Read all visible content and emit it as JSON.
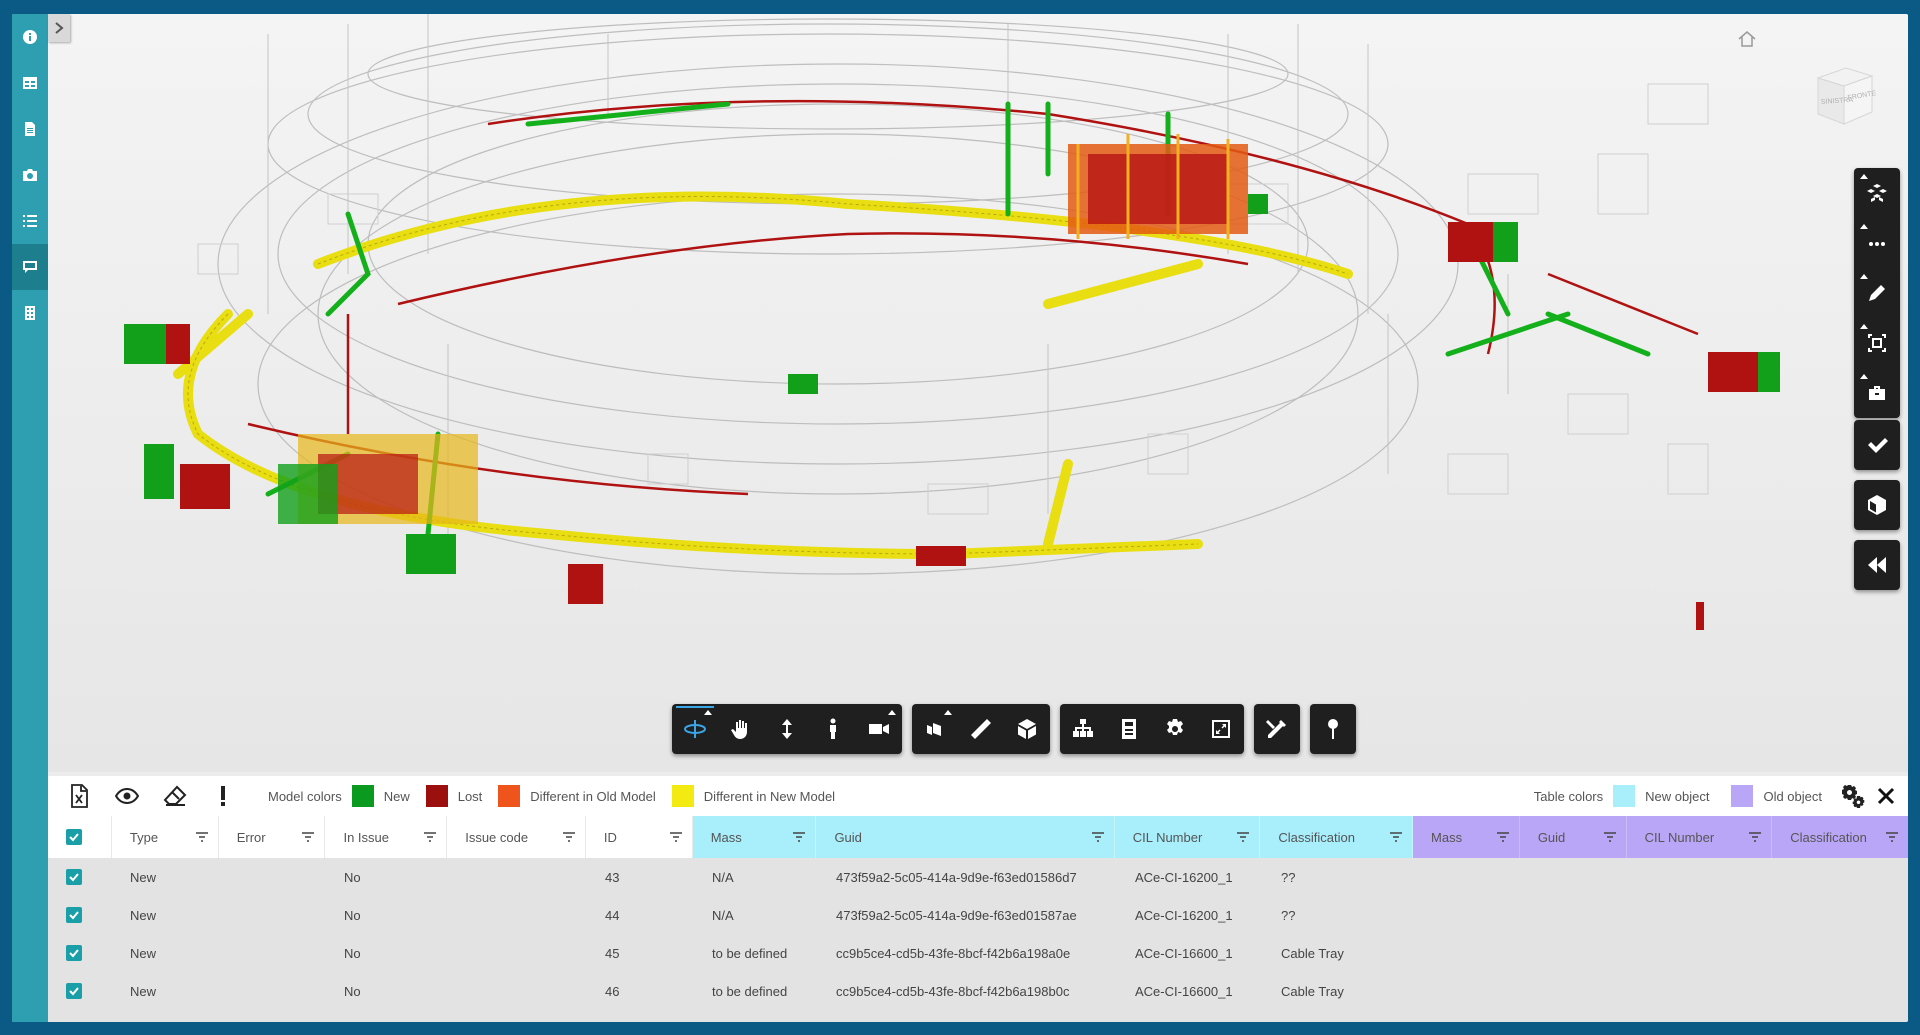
{
  "rail": {
    "items": [
      {
        "icon": "info-icon"
      },
      {
        "icon": "table-icon"
      },
      {
        "icon": "document-icon"
      },
      {
        "icon": "camera-icon"
      },
      {
        "icon": "list-icon"
      },
      {
        "icon": "comment-icon"
      },
      {
        "icon": "building-icon"
      }
    ],
    "active_index": 5
  },
  "viewer": {
    "navcube_labels": [
      "SINISTRA",
      "FRONTE"
    ]
  },
  "legend": {
    "model_colors_label": "Model colors",
    "items": [
      {
        "label": "New",
        "color": "#0a9a1f"
      },
      {
        "label": "Lost",
        "color": "#9c0f0f"
      },
      {
        "label": "Different in Old Model",
        "color": "#f0541d"
      },
      {
        "label": "Different in New Model",
        "color": "#f2ea10"
      }
    ],
    "table_colors_label": "Table colors",
    "table_items": [
      {
        "label": "New object",
        "color": "#a9eefb"
      },
      {
        "label": "Old object",
        "color": "#b9a6f6"
      }
    ]
  },
  "table": {
    "columns": [
      "Type",
      "Error",
      "In Issue",
      "Issue code",
      "ID",
      "Mass",
      "Guid",
      "CIL Number",
      "Classification",
      "Mass",
      "Guid",
      "CIL Number",
      "Classification"
    ],
    "rows": [
      {
        "type": "New",
        "error": "",
        "in_issue": "No",
        "issue_code": "",
        "id": "43",
        "mass": "N/A",
        "guid": "473f59a2-5c05-414a-9d9e-f63ed01586d7",
        "cil": "ACe-CI-16200_1",
        "classification": "??"
      },
      {
        "type": "New",
        "error": "",
        "in_issue": "No",
        "issue_code": "",
        "id": "44",
        "mass": "N/A",
        "guid": "473f59a2-5c05-414a-9d9e-f63ed01587ae",
        "cil": "ACe-CI-16200_1",
        "classification": "??"
      },
      {
        "type": "New",
        "error": "",
        "in_issue": "No",
        "issue_code": "",
        "id": "45",
        "mass": "to be defined",
        "guid": "cc9b5ce4-cd5b-43fe-8bcf-f42b6a198a0e",
        "cil": "ACe-CI-16600_1",
        "classification": "Cable Tray"
      },
      {
        "type": "New",
        "error": "",
        "in_issue": "No",
        "issue_code": "",
        "id": "46",
        "mass": "to be defined",
        "guid": "cc9b5ce4-cd5b-43fe-8bcf-f42b6a198b0c",
        "cil": "ACe-CI-16600_1",
        "classification": "Cable Tray"
      }
    ]
  }
}
